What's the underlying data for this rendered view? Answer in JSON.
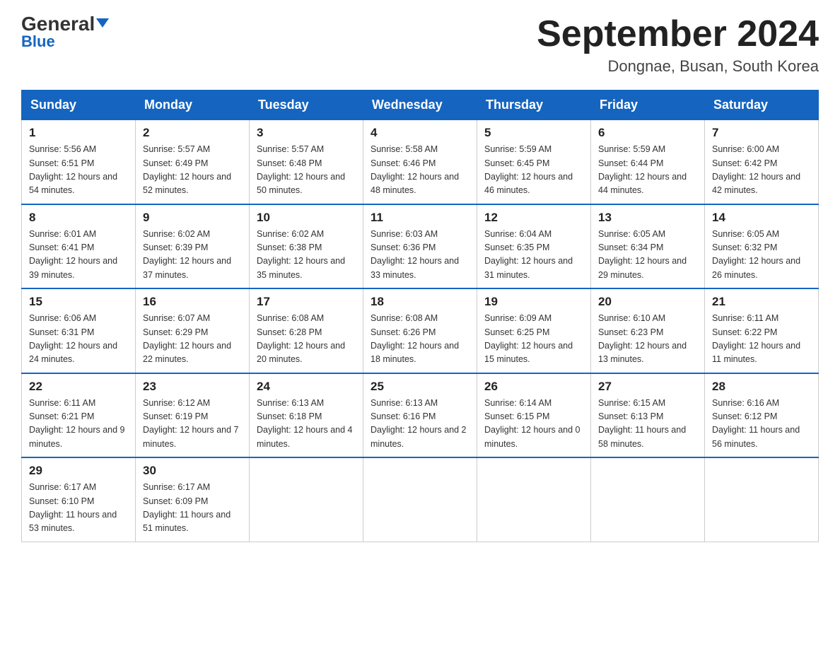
{
  "header": {
    "logo_top": "General",
    "logo_bottom": "Blue",
    "month_title": "September 2024",
    "location": "Dongnae, Busan, South Korea"
  },
  "weekdays": [
    "Sunday",
    "Monday",
    "Tuesday",
    "Wednesday",
    "Thursday",
    "Friday",
    "Saturday"
  ],
  "weeks": [
    [
      {
        "day": "1",
        "sunrise": "5:56 AM",
        "sunset": "6:51 PM",
        "daylight": "12 hours and 54 minutes."
      },
      {
        "day": "2",
        "sunrise": "5:57 AM",
        "sunset": "6:49 PM",
        "daylight": "12 hours and 52 minutes."
      },
      {
        "day": "3",
        "sunrise": "5:57 AM",
        "sunset": "6:48 PM",
        "daylight": "12 hours and 50 minutes."
      },
      {
        "day": "4",
        "sunrise": "5:58 AM",
        "sunset": "6:46 PM",
        "daylight": "12 hours and 48 minutes."
      },
      {
        "day": "5",
        "sunrise": "5:59 AM",
        "sunset": "6:45 PM",
        "daylight": "12 hours and 46 minutes."
      },
      {
        "day": "6",
        "sunrise": "5:59 AM",
        "sunset": "6:44 PM",
        "daylight": "12 hours and 44 minutes."
      },
      {
        "day": "7",
        "sunrise": "6:00 AM",
        "sunset": "6:42 PM",
        "daylight": "12 hours and 42 minutes."
      }
    ],
    [
      {
        "day": "8",
        "sunrise": "6:01 AM",
        "sunset": "6:41 PM",
        "daylight": "12 hours and 39 minutes."
      },
      {
        "day": "9",
        "sunrise": "6:02 AM",
        "sunset": "6:39 PM",
        "daylight": "12 hours and 37 minutes."
      },
      {
        "day": "10",
        "sunrise": "6:02 AM",
        "sunset": "6:38 PM",
        "daylight": "12 hours and 35 minutes."
      },
      {
        "day": "11",
        "sunrise": "6:03 AM",
        "sunset": "6:36 PM",
        "daylight": "12 hours and 33 minutes."
      },
      {
        "day": "12",
        "sunrise": "6:04 AM",
        "sunset": "6:35 PM",
        "daylight": "12 hours and 31 minutes."
      },
      {
        "day": "13",
        "sunrise": "6:05 AM",
        "sunset": "6:34 PM",
        "daylight": "12 hours and 29 minutes."
      },
      {
        "day": "14",
        "sunrise": "6:05 AM",
        "sunset": "6:32 PM",
        "daylight": "12 hours and 26 minutes."
      }
    ],
    [
      {
        "day": "15",
        "sunrise": "6:06 AM",
        "sunset": "6:31 PM",
        "daylight": "12 hours and 24 minutes."
      },
      {
        "day": "16",
        "sunrise": "6:07 AM",
        "sunset": "6:29 PM",
        "daylight": "12 hours and 22 minutes."
      },
      {
        "day": "17",
        "sunrise": "6:08 AM",
        "sunset": "6:28 PM",
        "daylight": "12 hours and 20 minutes."
      },
      {
        "day": "18",
        "sunrise": "6:08 AM",
        "sunset": "6:26 PM",
        "daylight": "12 hours and 18 minutes."
      },
      {
        "day": "19",
        "sunrise": "6:09 AM",
        "sunset": "6:25 PM",
        "daylight": "12 hours and 15 minutes."
      },
      {
        "day": "20",
        "sunrise": "6:10 AM",
        "sunset": "6:23 PM",
        "daylight": "12 hours and 13 minutes."
      },
      {
        "day": "21",
        "sunrise": "6:11 AM",
        "sunset": "6:22 PM",
        "daylight": "12 hours and 11 minutes."
      }
    ],
    [
      {
        "day": "22",
        "sunrise": "6:11 AM",
        "sunset": "6:21 PM",
        "daylight": "12 hours and 9 minutes."
      },
      {
        "day": "23",
        "sunrise": "6:12 AM",
        "sunset": "6:19 PM",
        "daylight": "12 hours and 7 minutes."
      },
      {
        "day": "24",
        "sunrise": "6:13 AM",
        "sunset": "6:18 PM",
        "daylight": "12 hours and 4 minutes."
      },
      {
        "day": "25",
        "sunrise": "6:13 AM",
        "sunset": "6:16 PM",
        "daylight": "12 hours and 2 minutes."
      },
      {
        "day": "26",
        "sunrise": "6:14 AM",
        "sunset": "6:15 PM",
        "daylight": "12 hours and 0 minutes."
      },
      {
        "day": "27",
        "sunrise": "6:15 AM",
        "sunset": "6:13 PM",
        "daylight": "11 hours and 58 minutes."
      },
      {
        "day": "28",
        "sunrise": "6:16 AM",
        "sunset": "6:12 PM",
        "daylight": "11 hours and 56 minutes."
      }
    ],
    [
      {
        "day": "29",
        "sunrise": "6:17 AM",
        "sunset": "6:10 PM",
        "daylight": "11 hours and 53 minutes."
      },
      {
        "day": "30",
        "sunrise": "6:17 AM",
        "sunset": "6:09 PM",
        "daylight": "11 hours and 51 minutes."
      },
      null,
      null,
      null,
      null,
      null
    ]
  ]
}
